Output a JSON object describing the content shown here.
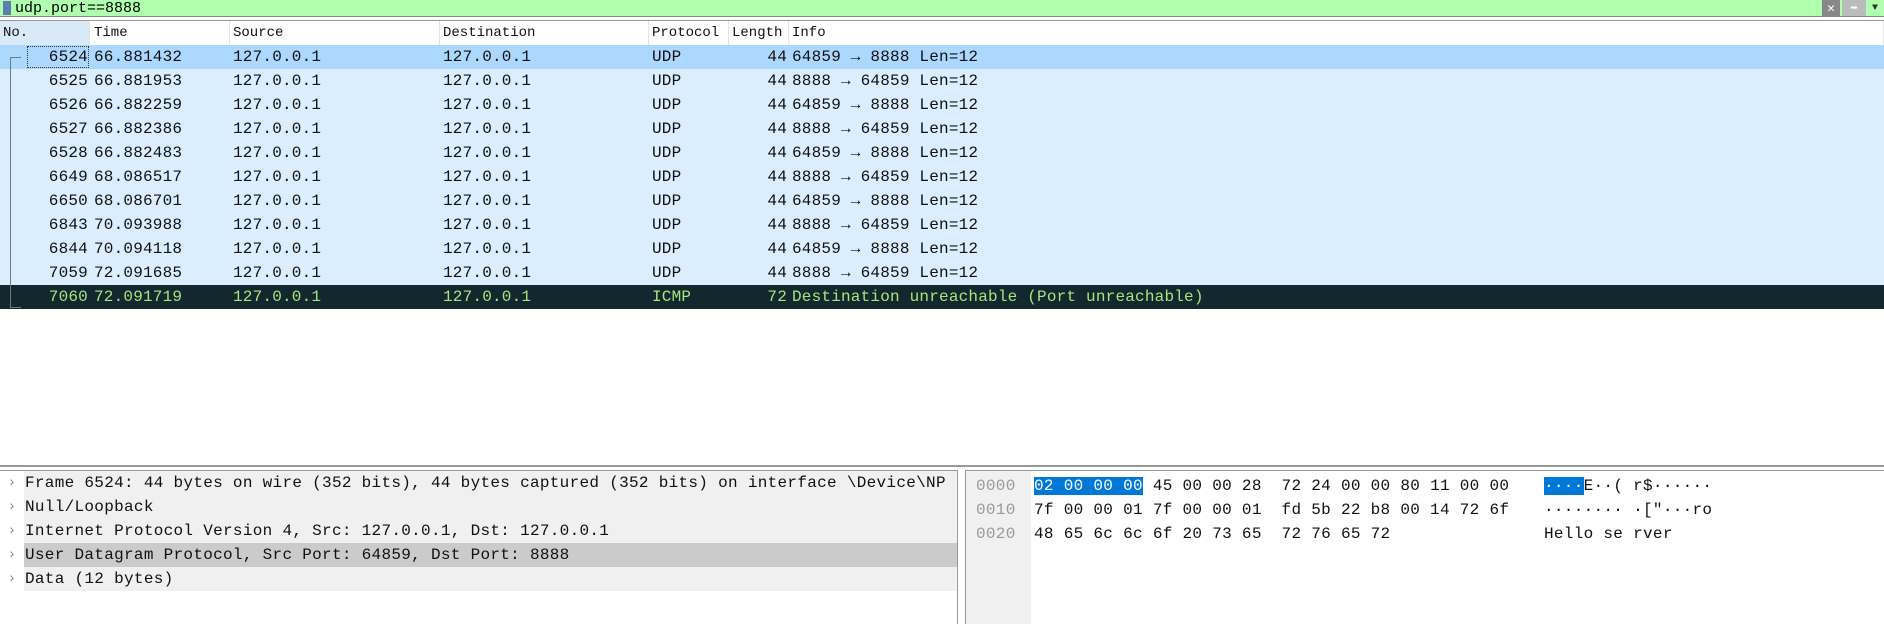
{
  "filter": {
    "value": "udp.port==8888",
    "clear_icon": "close-icon",
    "apply_icon": "arrow-right-icon",
    "dropdown_icon": "chevron-down-icon"
  },
  "columns": [
    "No.",
    "Time",
    "Source",
    "Destination",
    "Protocol",
    "Length",
    "Info"
  ],
  "packets": [
    [
      "6524",
      "66.881432",
      "127.0.0.1",
      "127.0.0.1",
      "UDP",
      "44",
      "64859 → 8888 Len=12"
    ],
    [
      "6525",
      "66.881953",
      "127.0.0.1",
      "127.0.0.1",
      "UDP",
      "44",
      "8888 → 64859 Len=12"
    ],
    [
      "6526",
      "66.882259",
      "127.0.0.1",
      "127.0.0.1",
      "UDP",
      "44",
      "64859 → 8888 Len=12"
    ],
    [
      "6527",
      "66.882386",
      "127.0.0.1",
      "127.0.0.1",
      "UDP",
      "44",
      "8888 → 64859 Len=12"
    ],
    [
      "6528",
      "66.882483",
      "127.0.0.1",
      "127.0.0.1",
      "UDP",
      "44",
      "64859 → 8888 Len=12"
    ],
    [
      "6649",
      "68.086517",
      "127.0.0.1",
      "127.0.0.1",
      "UDP",
      "44",
      "8888 → 64859 Len=12"
    ],
    [
      "6650",
      "68.086701",
      "127.0.0.1",
      "127.0.0.1",
      "UDP",
      "44",
      "64859 → 8888 Len=12"
    ],
    [
      "6843",
      "70.093988",
      "127.0.0.1",
      "127.0.0.1",
      "UDP",
      "44",
      "8888 → 64859 Len=12"
    ],
    [
      "6844",
      "70.094118",
      "127.0.0.1",
      "127.0.0.1",
      "UDP",
      "44",
      "64859 → 8888 Len=12"
    ],
    [
      "7059",
      "72.091685",
      "127.0.0.1",
      "127.0.0.1",
      "UDP",
      "44",
      "8888 → 64859 Len=12"
    ],
    [
      "7060",
      "72.091719",
      "127.0.0.1",
      "127.0.0.1",
      "ICMP",
      "72",
      "Destination unreachable (Port unreachable)"
    ]
  ],
  "details": [
    "Frame 6524: 44 bytes on wire (352 bits), 44 bytes captured (352 bits) on interface \\Device\\NP",
    "Null/Loopback",
    "Internet Protocol Version 4, Src: 127.0.0.1, Dst: 127.0.0.1",
    "User Datagram Protocol, Src Port: 64859, Dst Port: 8888",
    "Data (12 bytes)"
  ],
  "hex": [
    {
      "offset": "0000",
      "hl": "02 00 00 00",
      "bytes": " 45 00 00 28  72 24 00 00 80 11 00 00",
      "ascii_hl": "····",
      "ascii": "E··( r$······"
    },
    {
      "offset": "0010",
      "hl": "",
      "bytes": "7f 00 00 01 7f 00 00 01  fd 5b 22 b8 00 14 72 6f",
      "ascii_hl": "",
      "ascii": "········ ·[\"···ro"
    },
    {
      "offset": "0020",
      "hl": "",
      "bytes": "48 65 6c 6c 6f 20 73 65  72 76 65 72",
      "ascii_hl": "",
      "ascii": "Hello se rver"
    }
  ],
  "colors": {
    "filter_ok": "#afffaf",
    "selected_row": "#acd8fe",
    "row": "#daeeff",
    "icmp_bg": "#12272e",
    "icmp_fg": "#a9e47d",
    "byte_highlight": "#0078d7"
  }
}
